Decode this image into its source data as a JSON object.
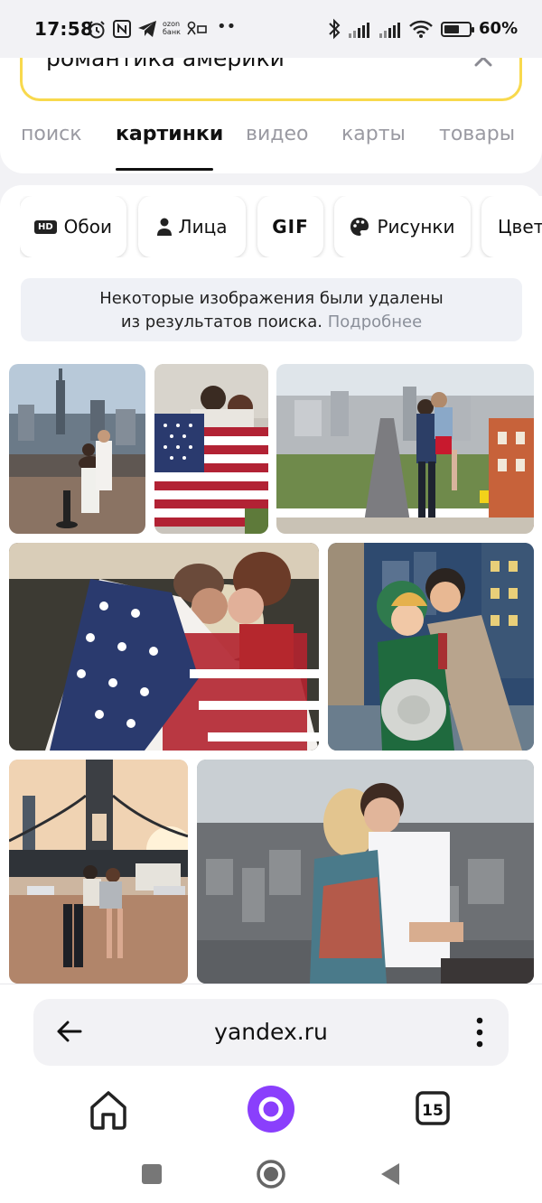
{
  "status_bar": {
    "time": "17:58",
    "battery_percent": "60",
    "battery_level": 0.6,
    "icons": [
      "alarm-icon",
      "nfc-icon",
      "telegram-icon",
      "ozon-bank-icon",
      "notification-icon",
      "bluetooth-icon",
      "signal-icon",
      "signal-icon",
      "wifi-icon",
      "battery-icon"
    ],
    "ozon_label_line1": "ozon",
    "ozon_label_line2": "банк",
    "more_dots": "••"
  },
  "search": {
    "query": "романтика америки",
    "clear_icon": "close-icon",
    "border_color": "#f8d94d"
  },
  "tabs": [
    {
      "label": "поиск",
      "active": false
    },
    {
      "label": "картинки",
      "active": true
    },
    {
      "label": "видео",
      "active": false
    },
    {
      "label": "карты",
      "active": false
    },
    {
      "label": "товары",
      "active": false
    }
  ],
  "filter_chips": [
    {
      "label": "Обои",
      "icon": "hd-icon",
      "badge": "HD"
    },
    {
      "label": "Лица",
      "icon": "person-icon"
    },
    {
      "label": "GIF",
      "icon": null
    },
    {
      "label": "Рисунки",
      "icon": "palette-icon"
    },
    {
      "label": "Цвет",
      "icon": null
    }
  ],
  "notice": {
    "line1": "Некоторые изображения были удалены",
    "line2": "из результатов поиска.",
    "link": "Подробнее"
  },
  "images": [
    {
      "alt": "couple at observation deck with city skyline"
    },
    {
      "alt": "couple with american flag"
    },
    {
      "alt": "couple kissing on san francisco street"
    },
    {
      "alt": "couple wrapped in american flag at sunset"
    },
    {
      "alt": "vintage illustrated couple embracing"
    },
    {
      "alt": "couple dancing near brooklyn bridge"
    },
    {
      "alt": "couple embracing above city view"
    }
  ],
  "browser_bar": {
    "url": "yandex.ru",
    "back_icon": "arrow-left-icon",
    "menu_icon": "more-vertical-icon",
    "tab_count": "15",
    "alice_color": "#8a3ffc"
  }
}
